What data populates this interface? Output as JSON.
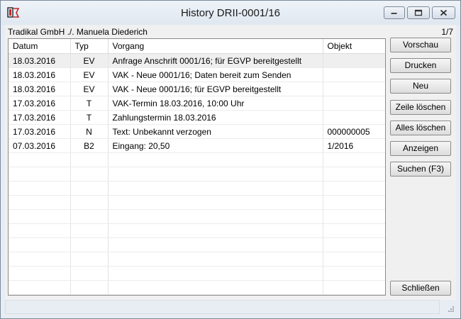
{
  "window": {
    "title": "History DRII-0001/16",
    "subtitle": "Tradikal GmbH ./. Manuela Diederich",
    "page_count": "1/7"
  },
  "table": {
    "columns": [
      "Datum",
      "Typ",
      "Vorgang",
      "Objekt"
    ],
    "rows": [
      {
        "datum": "18.03.2016",
        "typ": "EV",
        "vorgang": "Anfrage Anschrift 0001/16; für EGVP bereitgestellt",
        "objekt": "",
        "selected": true
      },
      {
        "datum": "18.03.2016",
        "typ": "EV",
        "vorgang": "VAK - Neue 0001/16; Daten bereit zum Senden",
        "objekt": ""
      },
      {
        "datum": "18.03.2016",
        "typ": "EV",
        "vorgang": "VAK - Neue 0001/16; für EGVP bereitgestellt",
        "objekt": ""
      },
      {
        "datum": "17.03.2016",
        "typ": "T",
        "vorgang": "VAK-Termin 18.03.2016, 10:00 Uhr",
        "objekt": ""
      },
      {
        "datum": "17.03.2016",
        "typ": "T",
        "vorgang": "Zahlungstermin 18.03.2016",
        "objekt": ""
      },
      {
        "datum": "17.03.2016",
        "typ": "N",
        "vorgang": "Text: Unbekannt verzogen",
        "objekt": "000000005"
      },
      {
        "datum": "07.03.2016",
        "typ": "B2",
        "vorgang": "Eingang: 20,50",
        "objekt": "1/2016"
      }
    ],
    "empty_rows": 10
  },
  "buttons": {
    "vorschau": "Vorschau",
    "drucken": "Drucken",
    "neu": "Neu",
    "zeile_loeschen": "Zeile löschen",
    "alles_loeschen": "Alles löschen",
    "anzeigen": "Anzeigen",
    "suchen": "Suchen (F3)",
    "schliessen": "Schließen"
  },
  "icons": {
    "app": "app-icon",
    "minimize": "minimize-icon",
    "maximize": "maximize-icon",
    "close": "close-icon",
    "grip": "resize-grip-icon"
  }
}
